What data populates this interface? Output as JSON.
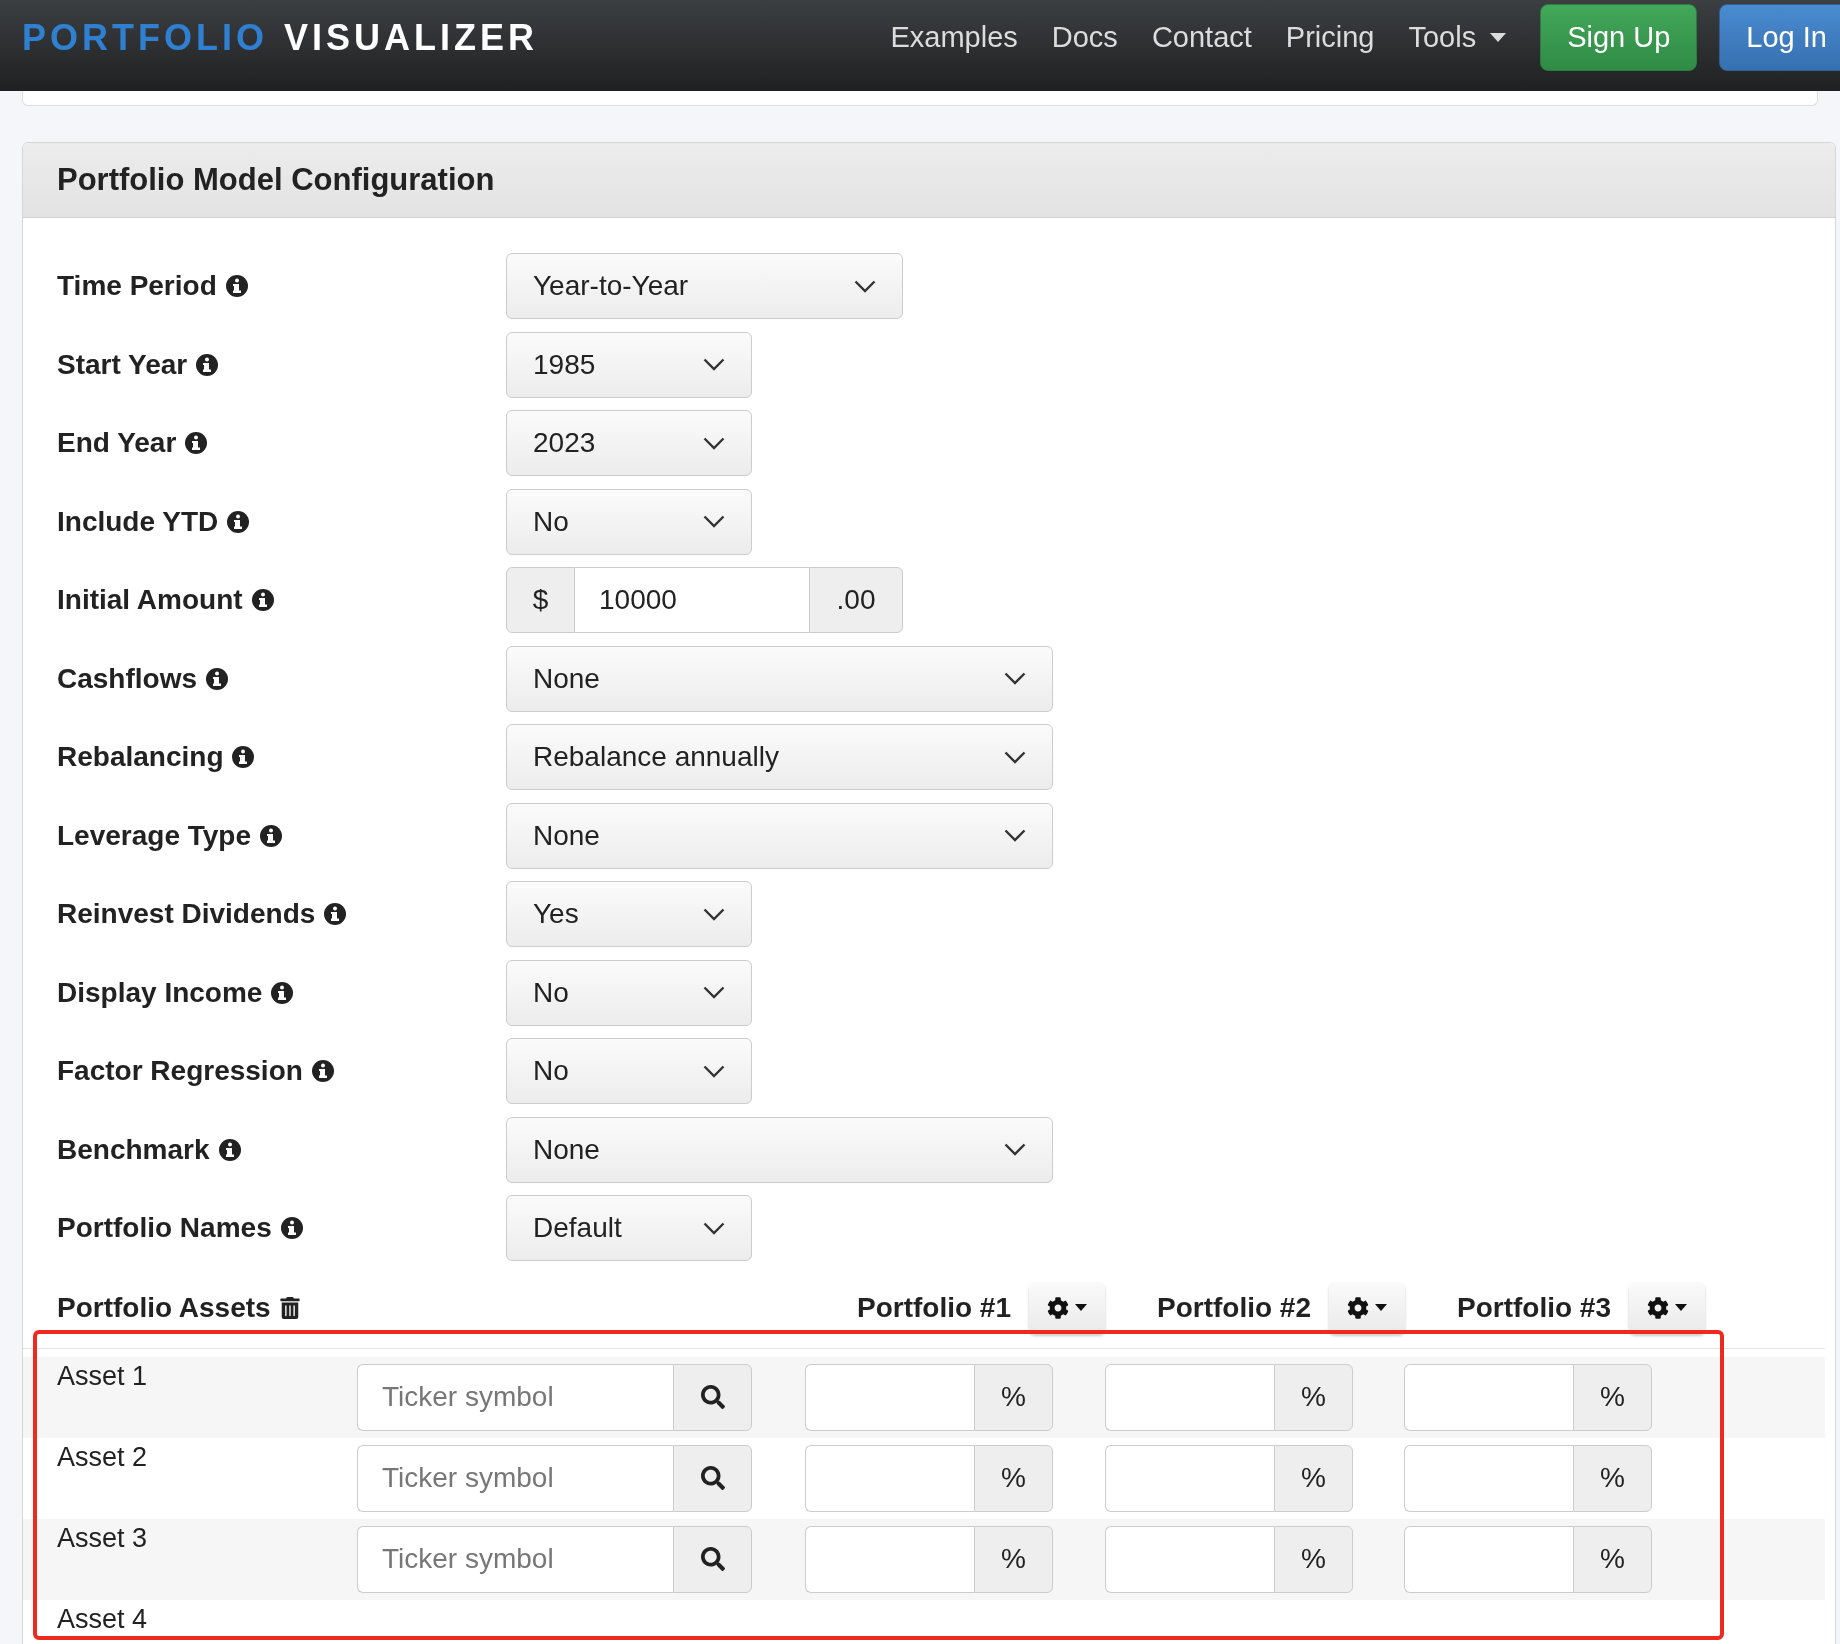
{
  "navbar": {
    "logo": {
      "part_1": "PORTFOLIO",
      "part_2": "VISUALIZER"
    },
    "links": [
      {
        "label": "Examples",
        "kind": "link"
      },
      {
        "label": "Docs",
        "kind": "link"
      },
      {
        "label": "Contact",
        "kind": "link"
      },
      {
        "label": "Pricing",
        "kind": "link"
      },
      {
        "label": "Tools",
        "kind": "dropdown"
      }
    ],
    "buttons": [
      {
        "label": "Sign Up",
        "kind": "success"
      },
      {
        "label": "Log In",
        "kind": "primary"
      }
    ]
  },
  "panel": {
    "title": "Portfolio Model Configuration",
    "fields": [
      {
        "label": "Time Period",
        "kind": "select",
        "value": "Year-to-Year"
      },
      {
        "label": "Start Year",
        "kind": "select",
        "value": "1985"
      },
      {
        "label": "End Year",
        "kind": "select",
        "value": "2023"
      },
      {
        "label": "Include YTD",
        "kind": "select",
        "value": "No"
      },
      {
        "label": "Initial Amount",
        "kind": "money",
        "prefix": "$",
        "value": "10000",
        "suffix": ".00"
      },
      {
        "label": "Cashflows",
        "kind": "select",
        "value": "None"
      },
      {
        "label": "Rebalancing",
        "kind": "select",
        "value": "Rebalance annually"
      },
      {
        "label": "Leverage Type",
        "kind": "select",
        "value": "None"
      },
      {
        "label": "Reinvest Dividends",
        "kind": "select",
        "value": "Yes"
      },
      {
        "label": "Display Income",
        "kind": "select",
        "value": "No"
      },
      {
        "label": "Factor Regression",
        "kind": "select",
        "value": "No"
      },
      {
        "label": "Benchmark",
        "kind": "select",
        "value": "None"
      },
      {
        "label": "Portfolio Names",
        "kind": "select",
        "value": "Default"
      }
    ],
    "assets": {
      "title": "Portfolio Assets",
      "portfolios": [
        "Portfolio #1",
        "Portfolio #2",
        "Portfolio #3"
      ],
      "rows": [
        {
          "label": "Asset 1",
          "ticker_placeholder": "Ticker symbol",
          "units": [
            "%",
            "%",
            "%"
          ]
        },
        {
          "label": "Asset 2",
          "ticker_placeholder": "Ticker symbol",
          "units": [
            "%",
            "%",
            "%"
          ]
        },
        {
          "label": "Asset 3",
          "ticker_placeholder": "Ticker symbol",
          "units": [
            "%",
            "%",
            "%"
          ]
        },
        {
          "label": "Asset 4"
        }
      ]
    }
  },
  "annotation": {
    "kind": "frame"
  }
}
